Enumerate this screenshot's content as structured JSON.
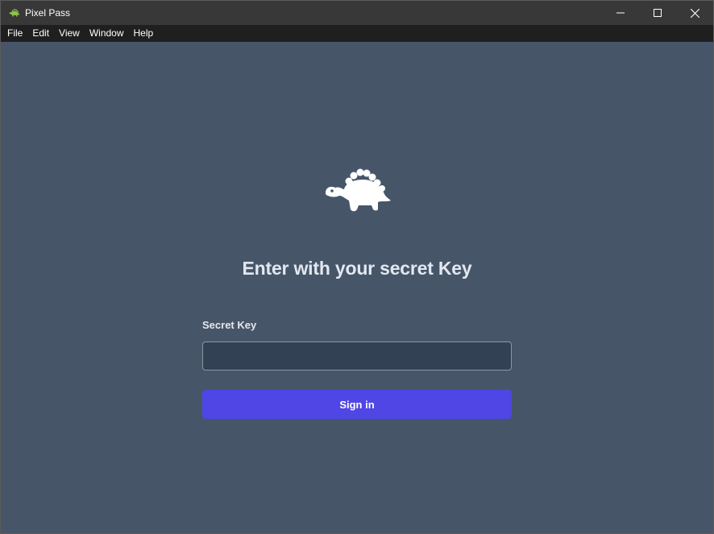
{
  "window": {
    "title": "Pixel Pass",
    "app_icon": "stegosaurus-icon",
    "controls": [
      "minimize-icon",
      "maximize-icon",
      "close-icon"
    ]
  },
  "menu": {
    "items": [
      {
        "label": "File"
      },
      {
        "label": "Edit"
      },
      {
        "label": "View"
      },
      {
        "label": "Window"
      },
      {
        "label": "Help"
      }
    ]
  },
  "login": {
    "logo_icon": "stegosaurus-icon",
    "heading": "Enter with your secret Key",
    "field_label": "Secret Key",
    "field_value": "",
    "field_placeholder": "",
    "button_label": "Sign in"
  },
  "colors": {
    "background": "#475569",
    "input_background": "#334155",
    "button": "#4f46e5",
    "titlebar": "#383838",
    "menubar": "#1f1f1f"
  }
}
